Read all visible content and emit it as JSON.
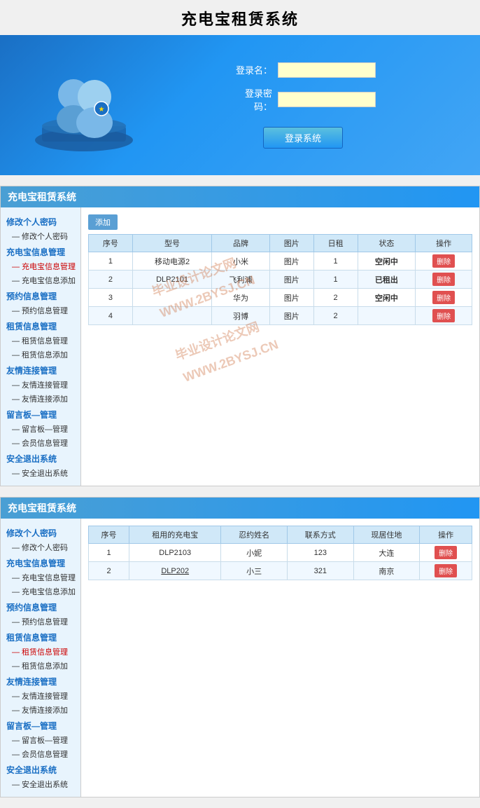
{
  "app": {
    "title": "充电宝租赁系统"
  },
  "login": {
    "username_label": "登录名：",
    "password_label": "登录密码：",
    "username_placeholder": "",
    "password_placeholder": "",
    "button_label": "登录系统"
  },
  "sidebar1": {
    "items": [
      {
        "label": "修改个人密码",
        "type": "group"
      },
      {
        "label": "— 修改个人密码",
        "type": "item"
      },
      {
        "label": "充电宝信息管理",
        "type": "group"
      },
      {
        "label": "— 充电宝信息管理",
        "type": "item"
      },
      {
        "label": "— 充电宝信息添加",
        "type": "item"
      },
      {
        "label": "预约信息管理",
        "type": "group"
      },
      {
        "label": "— 预约信息管理",
        "type": "item"
      },
      {
        "label": "租赁信息管理",
        "type": "group"
      },
      {
        "label": "— 租赁信息管理",
        "type": "item"
      },
      {
        "label": "— 租赁信息添加",
        "type": "item"
      },
      {
        "label": "友情连接管理",
        "type": "group"
      },
      {
        "label": "— 友情连接管理",
        "type": "item"
      },
      {
        "label": "— 友情连接添加",
        "type": "item"
      },
      {
        "label": "留言板—管理",
        "type": "group"
      },
      {
        "label": "— 留言板—管理",
        "type": "item"
      },
      {
        "label": "— 会员信息管理",
        "type": "item"
      },
      {
        "label": "安全退出系统",
        "type": "group"
      },
      {
        "label": "— 安全退出系统",
        "type": "item"
      }
    ]
  },
  "table1": {
    "add_button": "添加",
    "columns": [
      "序号",
      "型号",
      "品牌",
      "图片",
      "日租",
      "状态",
      "操作"
    ],
    "rows": [
      {
        "id": "1",
        "model": "移动电源2",
        "brand": "小米",
        "pic": "图片",
        "daily_rent": "1",
        "status": "空闲中",
        "status_type": "renting"
      },
      {
        "id": "2",
        "model": "DLP2101",
        "brand": "飞利浦",
        "pic": "图片",
        "daily_rent": "1",
        "status": "已租出",
        "status_type": "rented"
      },
      {
        "id": "3",
        "model": "",
        "brand": "华为",
        "pic": "图片",
        "daily_rent": "2",
        "status": "空闲中",
        "status_type": "renting"
      },
      {
        "id": "4",
        "model": "",
        "brand": "羽博",
        "pic": "图片",
        "daily_rent": "2",
        "status": "",
        "status_type": ""
      }
    ],
    "watermark1": "毕业设计论文网\nWWW.2BYSJ.CN",
    "watermark2": "毕业设计论文网\nWWW.2BYSJ.CN"
  },
  "sidebar2": {
    "items": [
      {
        "label": "修改个人密码",
        "type": "group"
      },
      {
        "label": "— 修改个人密码",
        "type": "item"
      },
      {
        "label": "充电宝信息管理",
        "type": "group"
      },
      {
        "label": "— 充电宝信息管理",
        "type": "item"
      },
      {
        "label": "— 充电宝信息添加",
        "type": "item"
      },
      {
        "label": "预约信息管理",
        "type": "group"
      },
      {
        "label": "— 预约信息管理",
        "type": "item"
      },
      {
        "label": "租赁信息管理",
        "type": "group"
      },
      {
        "label": "— 租赁信息管理",
        "type": "item"
      },
      {
        "label": "— 租赁信息添加",
        "type": "item"
      },
      {
        "label": "友情连接管理",
        "type": "group"
      },
      {
        "label": "— 友情连接管理",
        "type": "item"
      },
      {
        "label": "— 友情连接添加",
        "type": "item"
      },
      {
        "label": "留言板—管理",
        "type": "group"
      },
      {
        "label": "— 留言板—管理",
        "type": "item"
      },
      {
        "label": "— 会员信息管理",
        "type": "item"
      },
      {
        "label": "安全退出系统",
        "type": "group"
      },
      {
        "label": "— 安全退出系统",
        "type": "item"
      }
    ]
  },
  "table2": {
    "columns": [
      "序号",
      "租用的充电宝",
      "忍约姓名",
      "联系方式",
      "现居住地",
      "操作"
    ],
    "rows": [
      {
        "id": "1",
        "charger": "DLP2103",
        "name": "小妮",
        "contact": "123",
        "address": "大连"
      },
      {
        "id": "2",
        "charger": "DLP202",
        "name": "小三",
        "contact": "321",
        "address": "南京"
      }
    ]
  },
  "section1_title": "充电宝租赁系统",
  "section2_title": "充电宝租赁系统"
}
